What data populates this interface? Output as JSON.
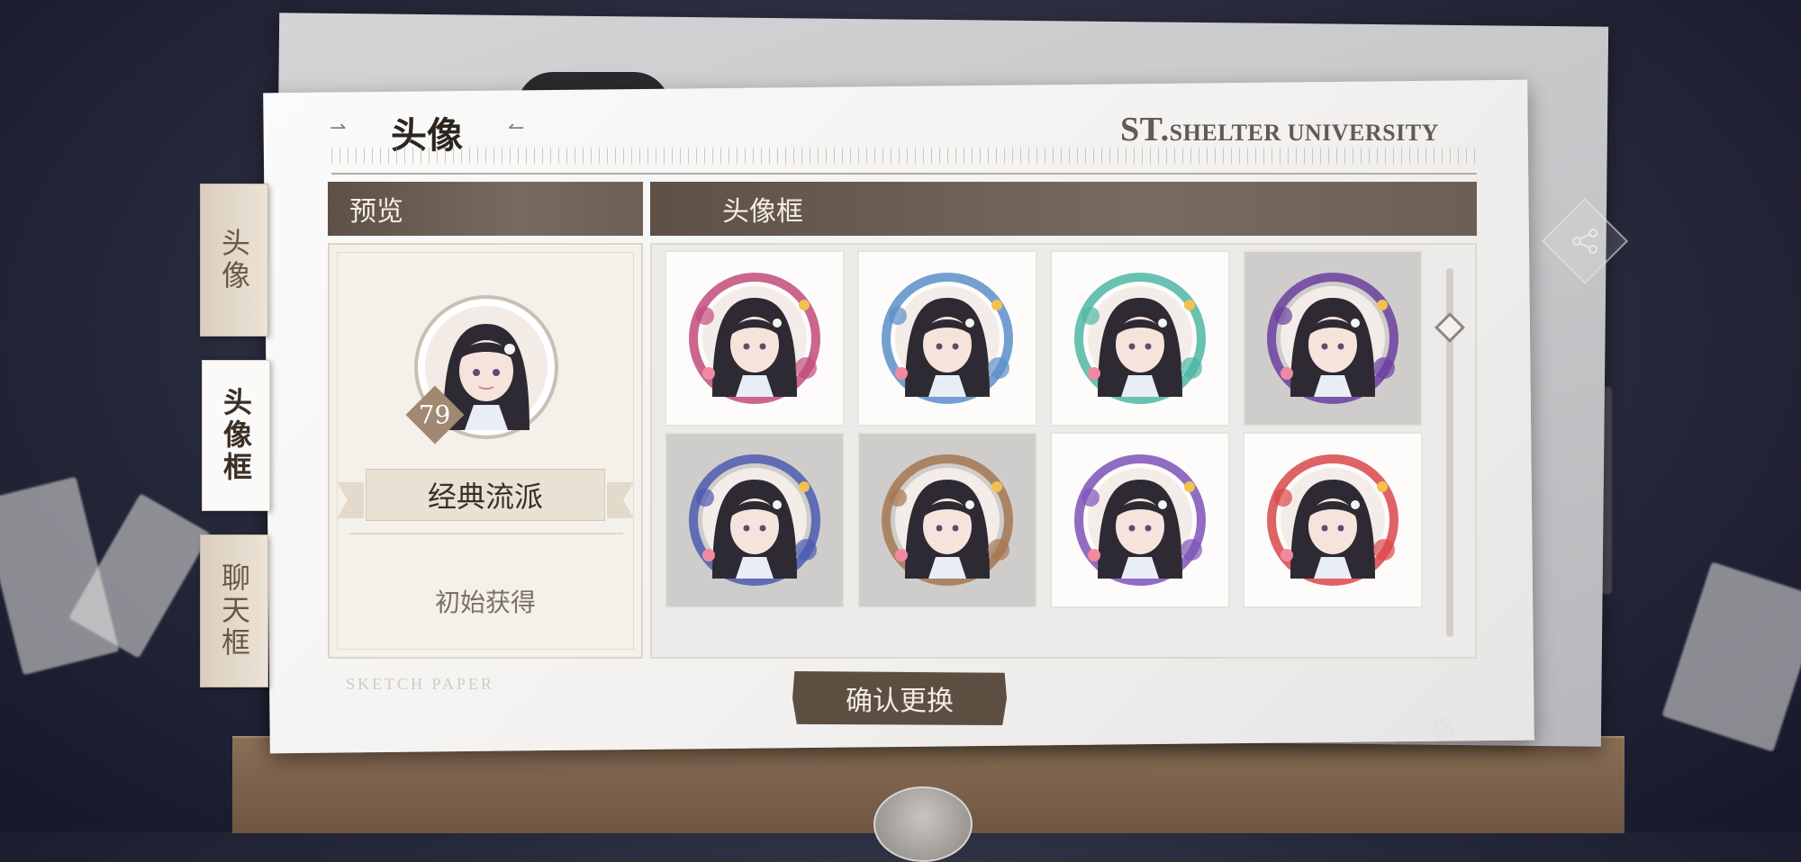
{
  "header": {
    "title": "头像",
    "brand_big": "ST.",
    "brand_small": "SHELTER UNIVERSITY"
  },
  "side_tabs": [
    {
      "label": "头像",
      "active": false
    },
    {
      "label": "头像框",
      "active": true
    },
    {
      "label": "聊天框",
      "active": false
    }
  ],
  "preview": {
    "section_label": "预览",
    "level": "79",
    "frame_name": "经典流派",
    "source": "初始获得",
    "watermark": "SKETCH PAPER"
  },
  "frames": {
    "section_label": "头像框",
    "items": [
      {
        "name": "ribbon-flower-frame",
        "locked": false,
        "accent": "#c24b7a"
      },
      {
        "name": "blue-crane-frame",
        "locked": false,
        "accent": "#5b8fc9"
      },
      {
        "name": "sun-popsicle-frame",
        "locked": false,
        "accent": "#4fb6a4"
      },
      {
        "name": "halloween-frame",
        "locked": true,
        "accent": "#6b3fa0"
      },
      {
        "name": "crown-dessert-frame",
        "locked": true,
        "accent": "#4c5ab0"
      },
      {
        "name": "butterfly-cage-frame",
        "locked": true,
        "accent": "#a57752"
      },
      {
        "name": "witch-hat-flower-frame",
        "locked": false,
        "accent": "#7d54b8"
      },
      {
        "name": "red-flower-fan-frame",
        "locked": false,
        "accent": "#d9474a"
      }
    ]
  },
  "confirm_label": "确认更换",
  "background_text": "格"
}
